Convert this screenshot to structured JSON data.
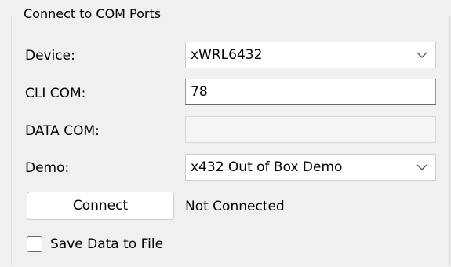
{
  "group": {
    "title": "Connect to COM Ports"
  },
  "device": {
    "label": "Device:",
    "value": "xWRL6432"
  },
  "cli_com": {
    "label": "CLI COM:",
    "value": "78"
  },
  "data_com": {
    "label": "DATA COM:",
    "value": ""
  },
  "demo": {
    "label": "Demo:",
    "value": "x432 Out of Box Demo"
  },
  "connect": {
    "button_label": "Connect",
    "status": "Not Connected"
  },
  "save": {
    "label": "Save Data to File",
    "checked": false
  },
  "icons": {
    "dropdown": "chevron-down-icon"
  }
}
